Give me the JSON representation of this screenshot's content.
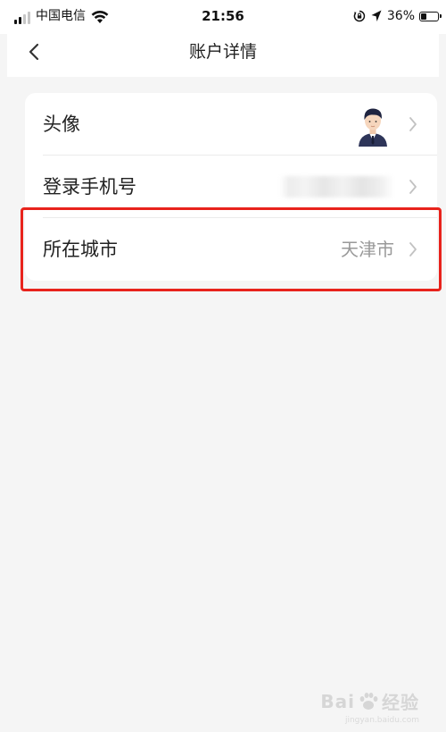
{
  "status_bar": {
    "carrier": "中国电信",
    "time": "21:56",
    "battery_percent": "36%",
    "battery_level": 0.36,
    "icons": [
      "signal-icon",
      "wifi-icon",
      "orientation-lock-icon",
      "location-icon",
      "battery-icon"
    ]
  },
  "nav": {
    "title": "账户详情",
    "back_icon": "chevron-left-icon"
  },
  "rows": [
    {
      "label": "头像",
      "value": "",
      "accessory": "avatar"
    },
    {
      "label": "登录手机号",
      "value": "",
      "accessory": "blurred"
    },
    {
      "label": "所在城市",
      "value": "天津市",
      "accessory": "text"
    }
  ],
  "colors": {
    "background": "#f5f5f5",
    "card": "#ffffff",
    "highlight": "#e8231c",
    "secondary_text": "#999999"
  },
  "watermark": {
    "text_left": "Bai",
    "text_right": "经验",
    "sub": "jingyan.baidu.com"
  }
}
